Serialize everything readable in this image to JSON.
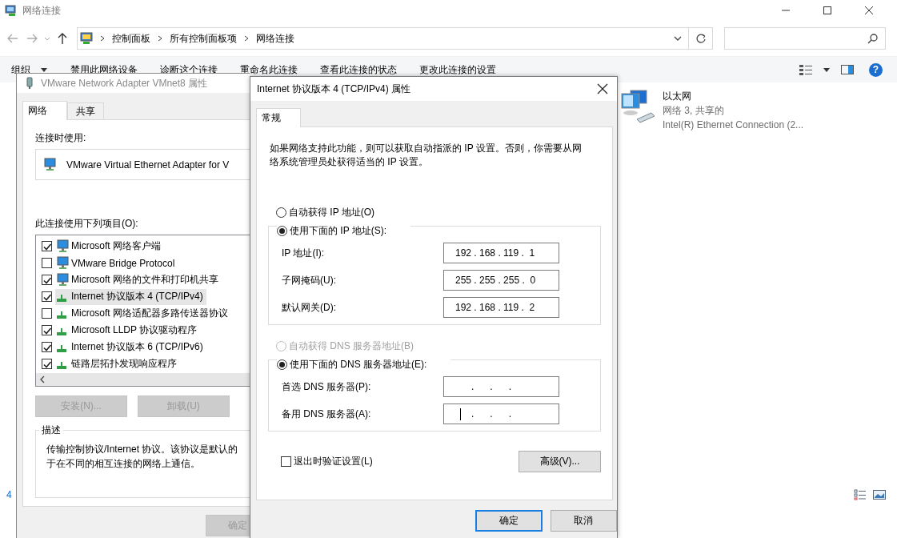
{
  "explorer": {
    "title": "网络连接",
    "breadcrumb": [
      "控制面板",
      "所有控制面板项",
      "网络连接"
    ],
    "toolbar": [
      {
        "label": "组织",
        "menu": true
      },
      {
        "label": "禁用此网络设备",
        "menu": false
      },
      {
        "label": "诊断这个连接",
        "menu": false
      },
      {
        "label": "重命名此连接",
        "menu": false
      },
      {
        "label": "查看此连接的状态",
        "menu": false
      },
      {
        "label": "更改此连接的设置",
        "menu": false
      }
    ],
    "help": "?",
    "items": [
      {
        "name": "以太网",
        "status": "网络 3, 共享的",
        "device": "Intel(R) Ethernet Connection (2..."
      }
    ],
    "status_bar": {
      "count": "4"
    }
  },
  "adapter_dialog": {
    "title": "VMware Network Adapter VMnet8 属性",
    "tabs": [
      {
        "label": "网络",
        "selected": true
      },
      {
        "label": "共享",
        "selected": false
      }
    ],
    "connect_using_label": "连接时使用:",
    "adapter": "VMware Virtual Ethernet Adapter for V",
    "items_label": "此连接使用下列项目(O):",
    "items": [
      {
        "label": "Microsoft 网络客户端",
        "kind": "service",
        "checked": true,
        "selected": false
      },
      {
        "label": "VMware Bridge Protocol",
        "kind": "service",
        "checked": false,
        "selected": false
      },
      {
        "label": "Microsoft 网络的文件和打印机共享",
        "kind": "service",
        "checked": true,
        "selected": false
      },
      {
        "label": "Internet 协议版本 4 (TCP/IPv4)",
        "kind": "protocol",
        "checked": true,
        "selected": true
      },
      {
        "label": "Microsoft 网络适配器多路传送器协议",
        "kind": "protocol",
        "checked": false,
        "selected": false
      },
      {
        "label": "Microsoft LLDP 协议驱动程序",
        "kind": "protocol",
        "checked": true,
        "selected": false
      },
      {
        "label": "Internet 协议版本 6 (TCP/IPv6)",
        "kind": "protocol",
        "checked": true,
        "selected": false
      },
      {
        "label": "链路层拓扑发现响应程序",
        "kind": "protocol",
        "checked": true,
        "selected": false
      }
    ],
    "buttons": [
      {
        "label": "安装(N)...",
        "disabled": true
      },
      {
        "label": "卸载(U)",
        "disabled": true
      }
    ],
    "description": {
      "title": "描述",
      "lines": [
        "传输控制协议/Internet 协议。该协议是默认的",
        "于在不同的相互连接的网络上通信。"
      ]
    },
    "ok_button": {
      "label": "确定",
      "disabled": true
    }
  },
  "ipv4_dialog": {
    "title": "Internet 协议版本 4 (TCP/IPv4) 属性",
    "tabs": [
      {
        "label": "常规",
        "selected": true
      }
    ],
    "intro": "如果网络支持此功能，则可以获取自动指派的 IP 设置。否则，你需要从网络系统管理员处获得适当的 IP 设置。",
    "ip_modes": [
      {
        "label": "自动获得 IP 地址(O)",
        "selected": false,
        "disabled": false
      },
      {
        "label": "使用下面的 IP 地址(S):",
        "selected": true,
        "disabled": false
      }
    ],
    "ip_fields": [
      {
        "label": "IP 地址(I):",
        "value": "192 . 168 . 119 .  1",
        "focused": false
      },
      {
        "label": "子网掩码(U):",
        "value": "255 . 255 . 255 .  0",
        "focused": false
      },
      {
        "label": "默认网关(D):",
        "value": "192 . 168 . 119 .  2",
        "focused": false
      }
    ],
    "dns_modes": [
      {
        "label": "自动获得 DNS 服务器地址(B)",
        "selected": false,
        "disabled": true
      },
      {
        "label": "使用下面的 DNS 服务器地址(E):",
        "selected": true,
        "disabled": false
      }
    ],
    "dns_fields": [
      {
        "label": "首选 DNS 服务器(P):",
        "value": "      .      .      .",
        "focused": false
      },
      {
        "label": "备用 DNS 服务器(A):",
        "value": "      .      .      .",
        "focused": true
      }
    ],
    "validate": {
      "label": "退出时验证设置(L)",
      "checked": false
    },
    "advanced_button": "高级(V)...",
    "buttons": [
      {
        "label": "确定",
        "default": true
      },
      {
        "label": "取消",
        "default": false
      }
    ]
  }
}
